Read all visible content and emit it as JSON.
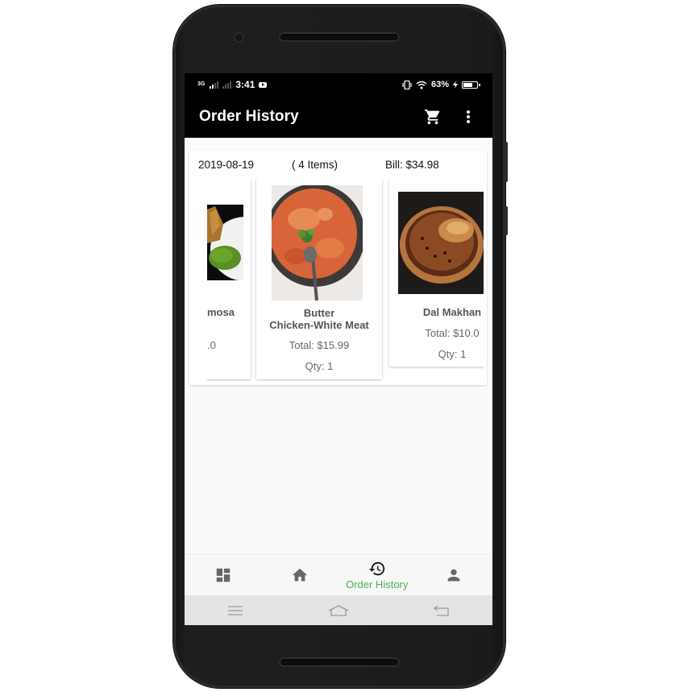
{
  "status_bar": {
    "network": "3G",
    "time": "3:41",
    "battery_percent": "63%",
    "battery_level": 0.63
  },
  "app_bar": {
    "title": "Order History",
    "icons": [
      "cart-icon",
      "more-vert-icon"
    ]
  },
  "order": {
    "date": "2019-08-19",
    "items_count": "( 4 Items)",
    "bill": "Bill: $34.98",
    "items": [
      {
        "name": "mosa",
        "total": ".0",
        "qty": ""
      },
      {
        "name": "Butter\nChicken-White Meat",
        "total": "Total: $15.99",
        "qty": "Qty: 1"
      },
      {
        "name": "Dal Makhan",
        "total": "Total: $10.0",
        "qty": "Qty: 1"
      }
    ]
  },
  "bottom_nav": {
    "items": [
      {
        "icon": "dashboard-icon",
        "label": ""
      },
      {
        "icon": "home-icon",
        "label": ""
      },
      {
        "icon": "history-icon",
        "label": "Order History",
        "active": true
      },
      {
        "icon": "account-icon",
        "label": ""
      }
    ],
    "active_color": "#4caf50"
  },
  "colors": {
    "app_bar": "#000000",
    "background": "#fafafa",
    "accent": "#4caf50"
  }
}
